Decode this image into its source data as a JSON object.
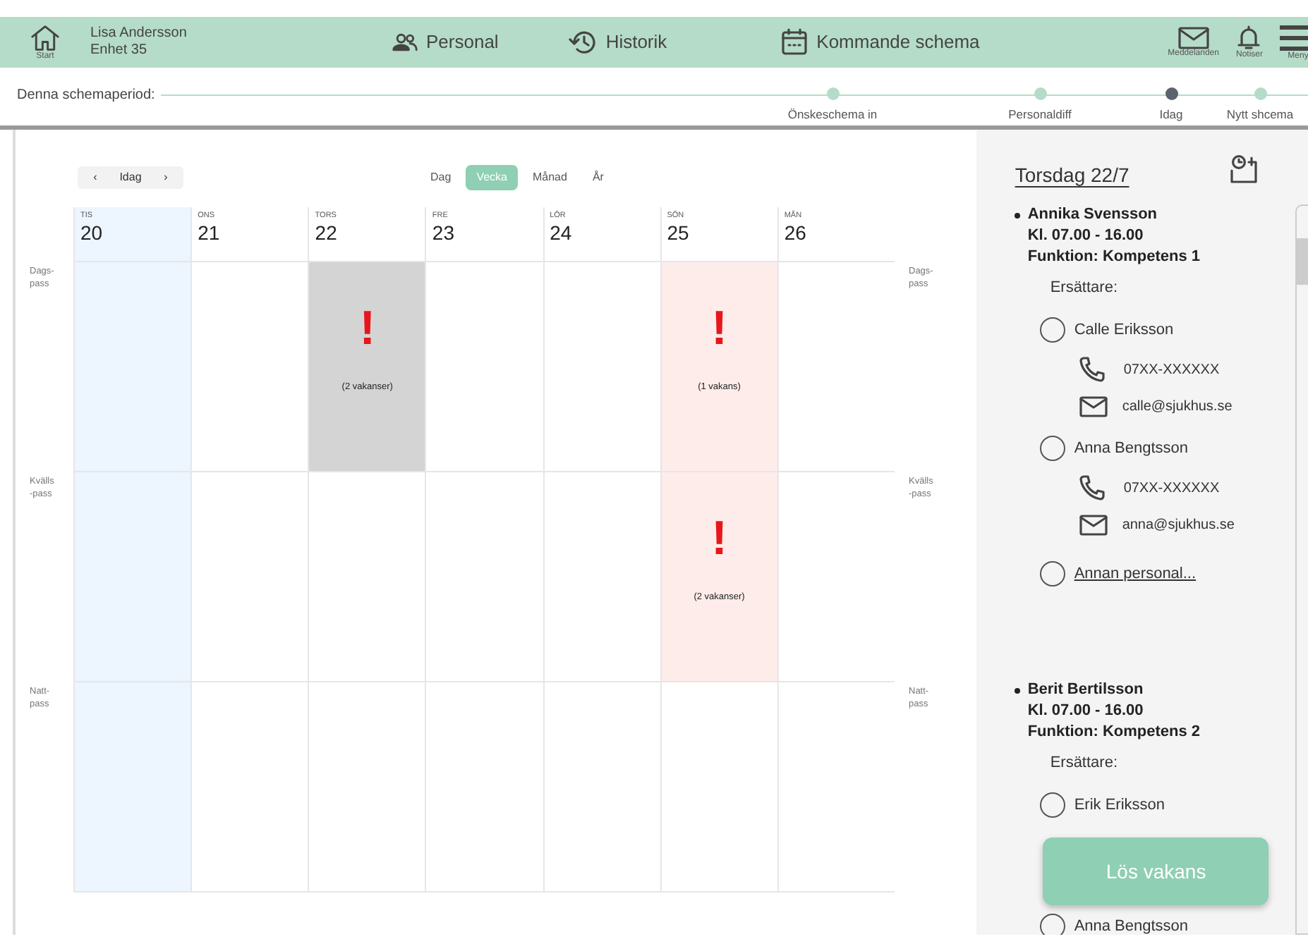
{
  "header": {
    "home_label": "Start",
    "user_name": "Lisa Andersson",
    "unit": "Enhet 35",
    "nav": [
      {
        "kind": "people",
        "label": "Personal"
      },
      {
        "kind": "history",
        "label": "Historik"
      },
      {
        "kind": "calendar",
        "label": "Kommande schema"
      }
    ],
    "actions": [
      {
        "kind": "mail",
        "label": "Meddelanden"
      },
      {
        "kind": "bell",
        "label": "Notiser"
      },
      {
        "kind": "menu",
        "label": "Meny"
      }
    ]
  },
  "timeline": {
    "label": "Denna schemaperiod:",
    "milestones": [
      {
        "label": "Önskeschema in",
        "current": false
      },
      {
        "label": "Personaldiff",
        "current": false
      },
      {
        "label": "Idag",
        "current": true
      },
      {
        "label": "Nytt shcema",
        "current": false
      }
    ]
  },
  "calendar": {
    "prev": "‹",
    "today_button": "Idag",
    "next": "›",
    "views": [
      {
        "label": "Dag",
        "selected": false
      },
      {
        "label": "Vecka",
        "selected": true
      },
      {
        "label": "Månad",
        "selected": false
      },
      {
        "label": "År",
        "selected": false
      }
    ],
    "days": [
      {
        "weekday": "TIS",
        "date": "20",
        "today": true
      },
      {
        "weekday": "ONS",
        "date": "21",
        "today": false
      },
      {
        "weekday": "TORS",
        "date": "22",
        "today": false
      },
      {
        "weekday": "FRE",
        "date": "23",
        "today": false
      },
      {
        "weekday": "LÖR",
        "date": "24",
        "today": false
      },
      {
        "weekday": "SÖN",
        "date": "25",
        "today": false
      },
      {
        "weekday": "MÅN",
        "date": "26",
        "today": false
      }
    ],
    "shifts": [
      {
        "label_left": "Dags-\npass",
        "label_right": "Dags-\npass",
        "cells": [
          {
            "selected": false
          },
          {
            "selected": false
          },
          {
            "selected": true,
            "mark": "!",
            "vacancy": "(2 vakanser)"
          },
          {
            "selected": false
          },
          {
            "selected": false
          },
          {
            "selected": false,
            "mark": "!",
            "vacancy": "(1 vakans)"
          },
          {
            "selected": false
          }
        ]
      },
      {
        "label_left": "Kvälls\n-pass",
        "label_right": "Kvälls\n-pass",
        "cells": [
          {
            "selected": false
          },
          {
            "selected": false
          },
          {
            "selected": false
          },
          {
            "selected": false
          },
          {
            "selected": false
          },
          {
            "selected": false,
            "mark": "!",
            "vacancy": "(2 vakanser)"
          },
          {
            "selected": false
          }
        ]
      },
      {
        "label_left": "Natt-\npass",
        "label_right": "Natt-\npass",
        "cells": [
          {
            "selected": false
          },
          {
            "selected": false
          },
          {
            "selected": false
          },
          {
            "selected": false
          },
          {
            "selected": false
          },
          {
            "selected": false
          },
          {
            "selected": false
          }
        ]
      }
    ]
  },
  "details": {
    "title": "Torsdag 22/7",
    "vacancies": [
      {
        "name": "Annika Svensson",
        "time": "Kl. 07.00 - 16.00",
        "function": "Funktion: Kompetens 1",
        "substitutes_label": "Ersättare:",
        "substitutes": [
          {
            "kind": "person",
            "name": "Calle Eriksson",
            "selected": false,
            "phone": "07XX-XXXXXX",
            "email": "calle@sjukhus.se"
          },
          {
            "kind": "person",
            "name": "Anna Bengtsson",
            "selected": false,
            "phone": "07XX-XXXXXX",
            "email": "anna@sjukhus.se"
          },
          {
            "kind": "link",
            "name": "Annan personal...",
            "selected": false
          }
        ]
      },
      {
        "name": "Berit Bertilsson",
        "time": "Kl. 07.00 - 16.00",
        "function": "Funktion: Kompetens 2",
        "substitutes_label": "Ersättare:",
        "substitutes": [
          {
            "kind": "person",
            "name": "Erik Eriksson",
            "selected": false
          },
          {
            "kind": "person",
            "name": "Anna Bengtsson",
            "selected": false
          }
        ]
      }
    ],
    "solve_button": "Lös vakans"
  }
}
